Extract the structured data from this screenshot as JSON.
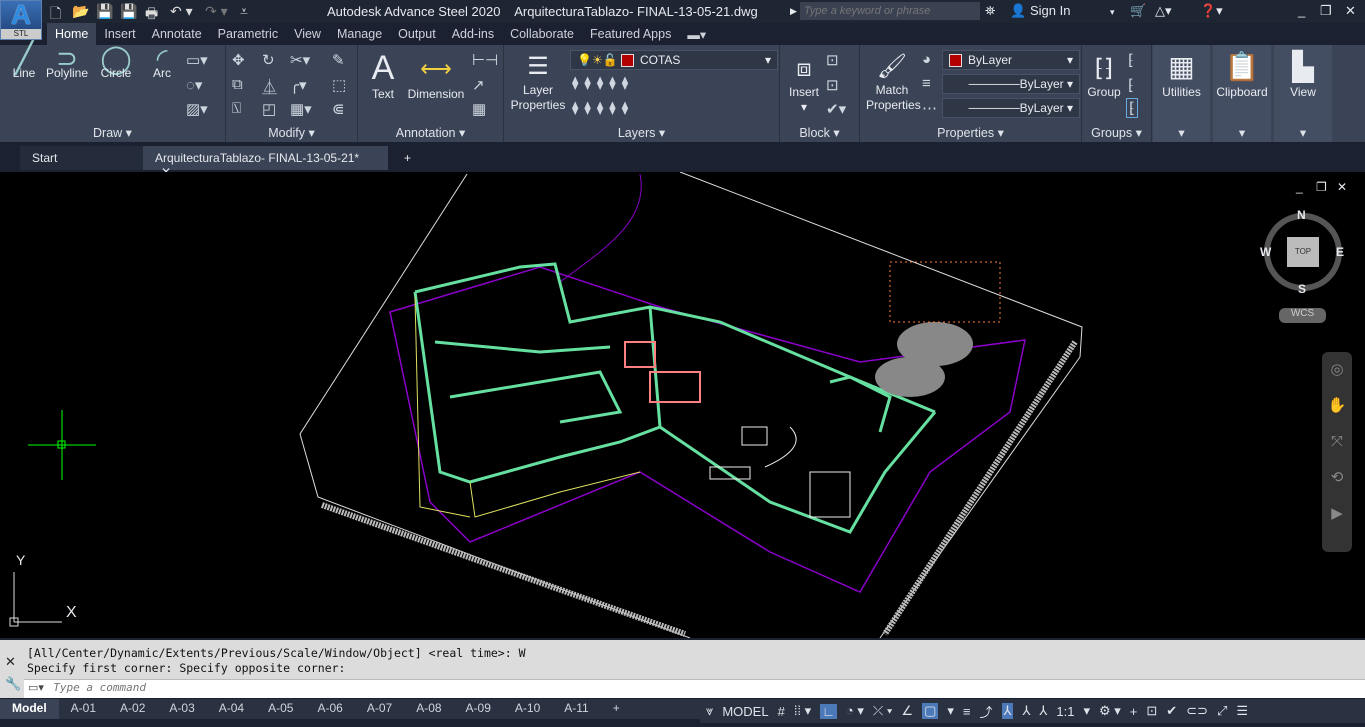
{
  "app": {
    "logo_text": "A",
    "logo_sub": "STL",
    "title": "Autodesk Advance Steel 2020    ArquitecturaTablazo- FINAL-13-05-21.dwg"
  },
  "search": {
    "placeholder": "Type a keyword or phrase"
  },
  "account": {
    "sign_in": "Sign In"
  },
  "menu_tabs": [
    "Home",
    "Insert",
    "Annotate",
    "Parametric",
    "View",
    "Manage",
    "Output",
    "Add-ins",
    "Collaborate",
    "Featured Apps"
  ],
  "ribbon": {
    "draw": {
      "label": "Draw",
      "tools": [
        "Line",
        "Polyline",
        "Circle",
        "Arc"
      ]
    },
    "modify": {
      "label": "Modify"
    },
    "annotation": {
      "label": "Annotation",
      "tools": [
        "Text",
        "Dimension"
      ]
    },
    "layers": {
      "label": "Layers",
      "layer_properties": "Layer Properties",
      "current_layer": "COTAS"
    },
    "block": {
      "label": "Block",
      "insert": "Insert"
    },
    "properties": {
      "label": "Properties",
      "match": "Match Properties",
      "color": "ByLayer",
      "linetype": "ByLayer",
      "lineweight": "ByLayer"
    },
    "groups": {
      "label": "Groups",
      "group": "Group"
    },
    "utilities": "Utilities",
    "clipboard": "Clipboard",
    "view": "View"
  },
  "file_tabs": [
    "Start",
    "ArquitecturaTablazo- FINAL-13-05-21*"
  ],
  "viewcube": {
    "n": "N",
    "s": "S",
    "e": "E",
    "w": "W",
    "top": "TOP",
    "wcs": "WCS"
  },
  "ucs": {
    "x": "X",
    "y": "Y"
  },
  "command": {
    "history": [
      "[All/Center/Dynamic/Extents/Previous/Scale/Window/Object] <real time>: W",
      "Specify first corner: Specify opposite corner:"
    ],
    "placeholder": "Type a command"
  },
  "layout_tabs": [
    "Model",
    "A-01",
    "A-02",
    "A-03",
    "A-04",
    "A-05",
    "A-06",
    "A-07",
    "A-08",
    "A-09",
    "A-10",
    "A-11"
  ],
  "status": {
    "model": "MODEL",
    "scale": "1:1"
  },
  "colors": {
    "layer_color": "#b30000",
    "accent": "#4c79b8",
    "walls": "#66e0a0",
    "boundary": "#8a00c8"
  }
}
